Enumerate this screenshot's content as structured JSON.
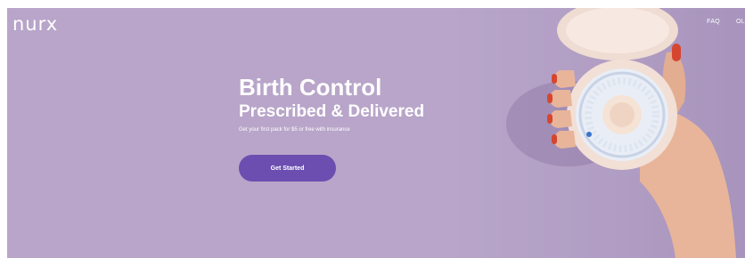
{
  "header": {
    "logo_text": "nurx",
    "nav": [
      "FAQ",
      "OL"
    ]
  },
  "hero": {
    "title": "Birth Control",
    "subtitle": "Prescribed & Delivered",
    "tagline": "Get your first pack for $5 or free with insurance",
    "cta_label": "Get Started",
    "background_color": "#b8a5c9",
    "cta_color": "#6b4eb0"
  }
}
